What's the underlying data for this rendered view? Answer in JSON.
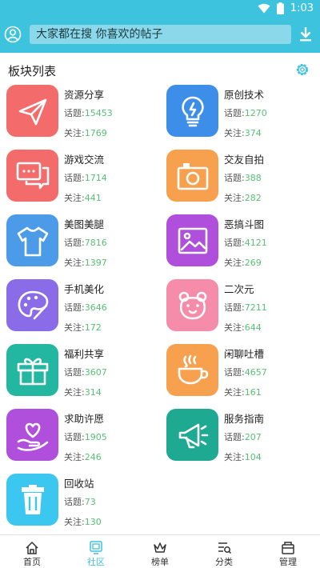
{
  "status": {
    "time": "1:03"
  },
  "search": {
    "placeholder": "大家都在搜 你喜欢的帖子"
  },
  "section": {
    "title": "板块列表"
  },
  "stat_labels": {
    "topics": "话题:",
    "follows": "关注:"
  },
  "boards": [
    {
      "name": "资源分享",
      "topics": "15453",
      "follows": "1769",
      "icon": "paper-plane-icon",
      "color": "#f36b6b"
    },
    {
      "name": "原创技术",
      "topics": "1270",
      "follows": "374",
      "icon": "lightbulb-icon",
      "color": "#3d8ee8"
    },
    {
      "name": "游戏交流",
      "topics": "1714",
      "follows": "441",
      "icon": "chat-bubbles-icon",
      "color": "#f36b6b"
    },
    {
      "name": "交友自拍",
      "topics": "388",
      "follows": "282",
      "icon": "camera-icon",
      "color": "#f7a04e"
    },
    {
      "name": "美图美腿",
      "topics": "7816",
      "follows": "1397",
      "icon": "tshirt-icon",
      "color": "#4b9be8"
    },
    {
      "name": "恶搞斗图",
      "topics": "4121",
      "follows": "269",
      "icon": "image-icon",
      "color": "#b04fdc"
    },
    {
      "name": "手机美化",
      "topics": "3646",
      "follows": "172",
      "icon": "palette-icon",
      "color": "#8a6be8"
    },
    {
      "name": "二次元",
      "topics": "7211",
      "follows": "644",
      "icon": "bear-face-icon",
      "color": "#f58ca9"
    },
    {
      "name": "福利共享",
      "topics": "3607",
      "follows": "314",
      "icon": "gift-icon",
      "color": "#23b7a2"
    },
    {
      "name": "闲聊吐槽",
      "topics": "4657",
      "follows": "161",
      "icon": "coffee-cup-icon",
      "color": "#f7a04e"
    },
    {
      "name": "求助许愿",
      "topics": "1905",
      "follows": "246",
      "icon": "heart-hand-icon",
      "color": "#b04fdc"
    },
    {
      "name": "服务指南",
      "topics": "207",
      "follows": "104",
      "icon": "megaphone-icon",
      "color": "#1ea992"
    },
    {
      "name": "回收站",
      "topics": "73",
      "follows": "130",
      "icon": "trash-icon",
      "color": "#3bc7f0"
    }
  ],
  "tabs": [
    {
      "label": "首页",
      "icon": "home-icon",
      "active": false
    },
    {
      "label": "社区",
      "icon": "community-icon",
      "active": true
    },
    {
      "label": "榜单",
      "icon": "crown-icon",
      "active": false
    },
    {
      "label": "分类",
      "icon": "category-search-icon",
      "active": false
    },
    {
      "label": "管理",
      "icon": "manage-box-icon",
      "active": false
    }
  ],
  "colors": {
    "primary": "#3ec3de",
    "stat_number": "#57c074"
  }
}
